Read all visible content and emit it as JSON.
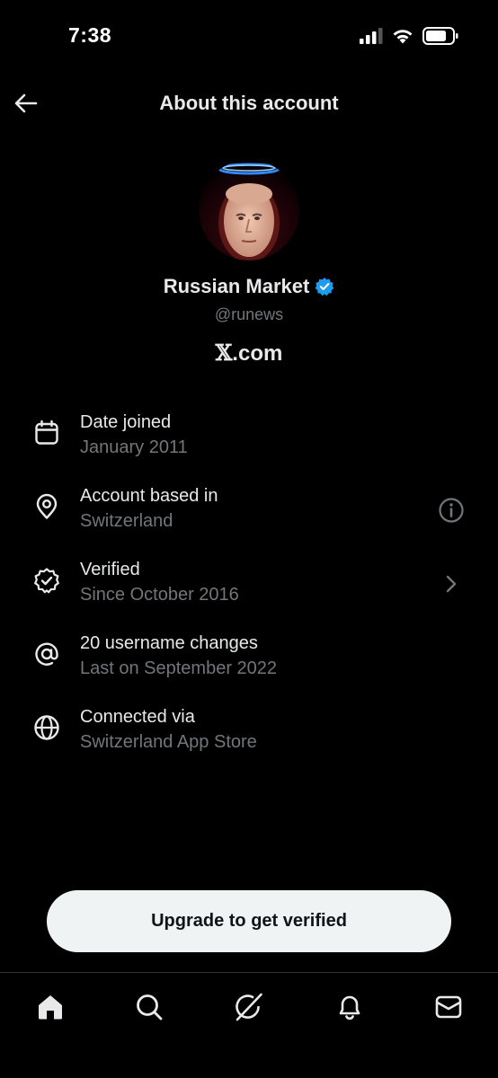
{
  "status_bar": {
    "time": "7:38",
    "icons": [
      "cellular-signal-icon",
      "wifi-icon",
      "battery-icon"
    ]
  },
  "header": {
    "back_icon": "arrow-left-icon",
    "title": "About this account"
  },
  "profile": {
    "display_name": "Russian Market",
    "verified_badge": "verified-badge-icon",
    "handle": "@runews",
    "site_mark": "𝕏",
    "site_suffix": ".com"
  },
  "info_items": [
    {
      "icon": "calendar-icon",
      "title": "Date joined",
      "subtitle": "January 2011"
    },
    {
      "icon": "location-pin-icon",
      "title": "Account based in",
      "subtitle": "Switzerland",
      "trailing": "info-icon"
    },
    {
      "icon": "verified-outline-icon",
      "title": "Verified",
      "subtitle": "Since October 2016",
      "trailing": "chevron-right-icon"
    },
    {
      "icon": "at-sign-icon",
      "title": "20 username changes",
      "subtitle": "Last on September 2022"
    },
    {
      "icon": "globe-icon",
      "title": "Connected via",
      "subtitle": "Switzerland App Store"
    }
  ],
  "upgrade_button": {
    "label": "Upgrade to get verified"
  },
  "bottom_nav": [
    {
      "icon": "home-icon",
      "active": true
    },
    {
      "icon": "search-icon"
    },
    {
      "icon": "grok-icon"
    },
    {
      "icon": "bell-icon"
    },
    {
      "icon": "mail-icon"
    }
  ],
  "colors": {
    "background": "#000000",
    "primary_text": "#e7e9ea",
    "secondary_text": "#71767b",
    "verified_blue": "#1d9bf0",
    "button_bg": "#eff3f4"
  }
}
